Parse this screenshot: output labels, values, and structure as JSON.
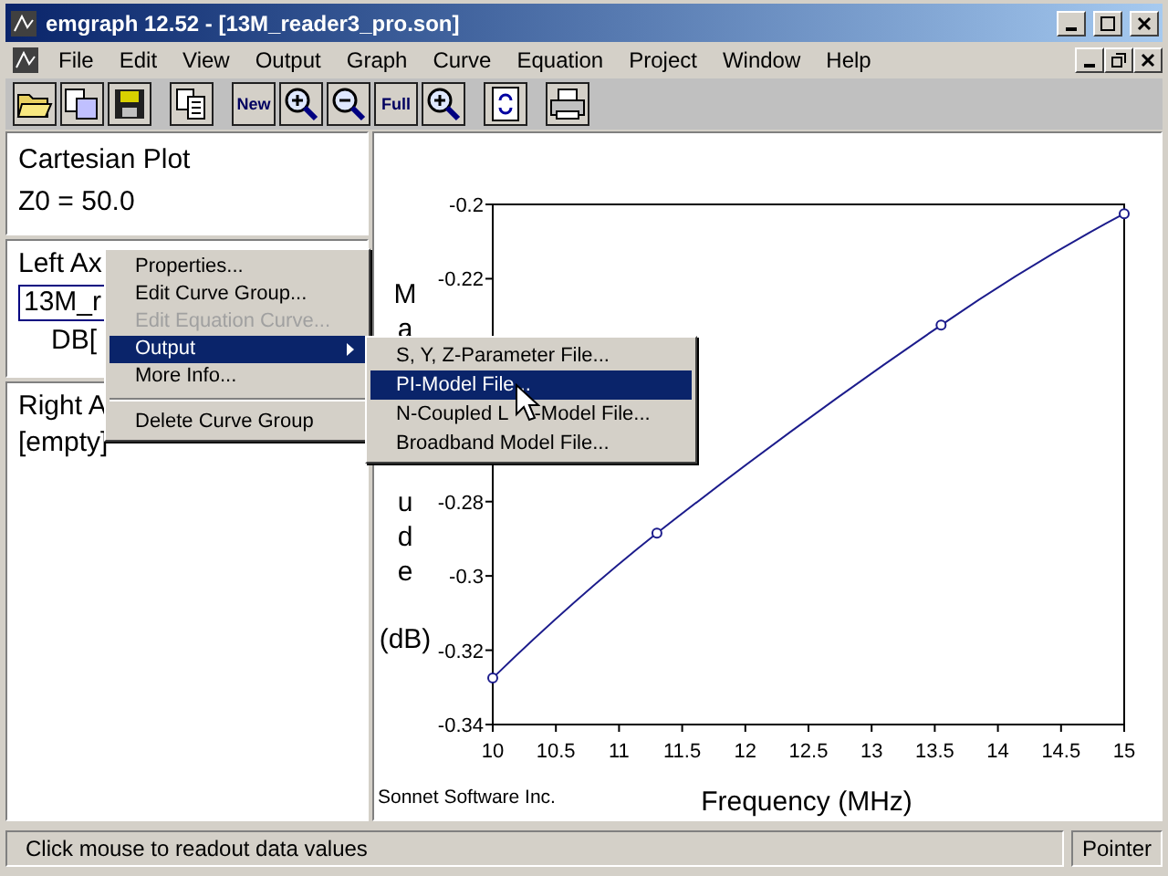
{
  "window": {
    "title": "emgraph 12.52 - [13M_reader3_pro.son]"
  },
  "menu": [
    {
      "label": "File"
    },
    {
      "label": "Edit"
    },
    {
      "label": "View"
    },
    {
      "label": "Output"
    },
    {
      "label": "Graph"
    },
    {
      "label": "Curve"
    },
    {
      "label": "Equation"
    },
    {
      "label": "Project"
    },
    {
      "label": "Window"
    },
    {
      "label": "Help"
    }
  ],
  "toolbar": [
    {
      "kind": "open"
    },
    {
      "kind": "save-as"
    },
    {
      "kind": "save"
    },
    {
      "kind": "separator"
    },
    {
      "kind": "copy"
    },
    {
      "kind": "separator"
    },
    {
      "kind": "new",
      "label": "New"
    },
    {
      "kind": "zoom-in"
    },
    {
      "kind": "zoom-out"
    },
    {
      "kind": "full",
      "label": "Full"
    },
    {
      "kind": "zoom-both"
    },
    {
      "kind": "separator"
    },
    {
      "kind": "refresh"
    },
    {
      "kind": "separator"
    },
    {
      "kind": "print"
    }
  ],
  "left_panel": {
    "plot_info": [
      "Cartesian Plot",
      "Z0 = 50.0"
    ],
    "left_axis": {
      "title": "Left Ax",
      "curve": "13M_r",
      "trace": "DB["
    },
    "right_axis": {
      "title": "Right A",
      "curve": "[empty]"
    }
  },
  "context_menu": [
    {
      "kind": "item",
      "label": "Properties...",
      "disabled": false,
      "selected": false,
      "submenu": false
    },
    {
      "kind": "item",
      "label": "Edit Curve Group...",
      "disabled": false,
      "selected": false,
      "submenu": false
    },
    {
      "kind": "item",
      "label": "Edit Equation Curve...",
      "disabled": true,
      "selected": false,
      "submenu": false
    },
    {
      "kind": "item",
      "label": "Output",
      "disabled": false,
      "selected": true,
      "submenu": true
    },
    {
      "kind": "item",
      "label": "More Info...",
      "disabled": false,
      "selected": false,
      "submenu": false
    },
    {
      "kind": "separator"
    },
    {
      "kind": "item",
      "label": "Delete Curve Group",
      "disabled": false,
      "selected": false,
      "submenu": false
    }
  ],
  "submenu": [
    {
      "label": "S, Y, Z-Parameter File...",
      "selected": false
    },
    {
      "label": "PI-Model File...",
      "selected": true
    },
    {
      "label": "N-Coupled L",
      "label_after_pointer": "-Model File...",
      "selected": false
    },
    {
      "label": "Broadband Model File...",
      "selected": false
    }
  ],
  "graph": {
    "ylabel_top": [
      "M",
      "a"
    ],
    "ylabel_bottom": [
      "u",
      "d",
      "e"
    ],
    "ylabel_unit": "(dB)",
    "credit": "Sonnet Software Inc.",
    "chart_data": {
      "type": "line",
      "xlabel": "Frequency (MHz)",
      "x": [
        10,
        11.3,
        13.55,
        15
      ],
      "series": [
        {
          "color": "#1c1c8c",
          "marker": "circle",
          "values": [
            -0.3275,
            -0.2885,
            -0.2325,
            -0.2025
          ]
        }
      ],
      "xlim": [
        10,
        15
      ],
      "ylim": [
        -0.34,
        -0.2
      ],
      "xticks": [
        10,
        10.5,
        11,
        11.5,
        12,
        12.5,
        13,
        13.5,
        14,
        14.5,
        15
      ],
      "yticks": [
        -0.34,
        -0.32,
        -0.3,
        -0.28,
        -0.22,
        -0.2
      ]
    }
  },
  "status_bar": {
    "message": "Click mouse to readout data values",
    "mode": "Pointer"
  }
}
